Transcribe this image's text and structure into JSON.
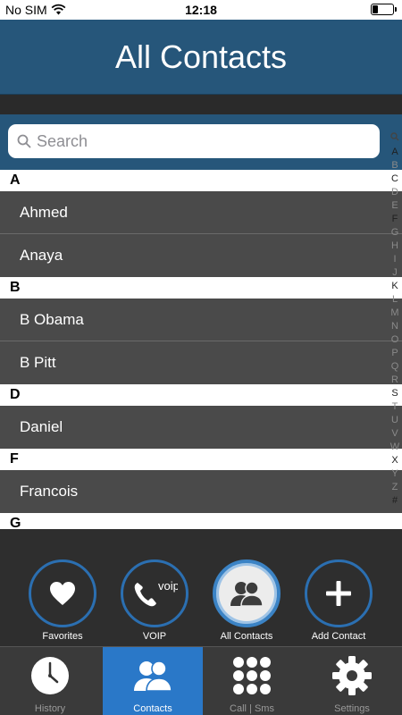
{
  "status_bar": {
    "carrier": "No SIM",
    "time": "12:18",
    "battery_level": 0.25
  },
  "header": {
    "title": "All Contacts"
  },
  "search": {
    "placeholder": "Search"
  },
  "sections": [
    {
      "letter": "A",
      "contacts": [
        "Ahmed",
        "Anaya"
      ]
    },
    {
      "letter": "B",
      "contacts": [
        "B Obama",
        "B Pitt"
      ]
    },
    {
      "letter": "D",
      "contacts": [
        "Daniel"
      ]
    },
    {
      "letter": "F",
      "contacts": [
        "Francois"
      ]
    },
    {
      "letter": "G",
      "contacts": []
    }
  ],
  "index_letters": [
    "A",
    "B",
    "C",
    "D",
    "E",
    "F",
    "G",
    "H",
    "I",
    "J",
    "K",
    "L",
    "M",
    "N",
    "O",
    "P",
    "Q",
    "R",
    "S",
    "T",
    "U",
    "V",
    "W",
    "X",
    "Y",
    "Z",
    "#"
  ],
  "action_buttons": [
    {
      "label": "Favorites",
      "icon": "heart-icon"
    },
    {
      "label": "VOIP",
      "icon": "voip-phone-icon",
      "icon_text": "voip"
    },
    {
      "label": "All Contacts",
      "icon": "contacts-icon",
      "active": true
    },
    {
      "label": "Add Contact",
      "icon": "plus-icon"
    }
  ],
  "tabs": [
    {
      "label": "History",
      "icon": "clock-icon"
    },
    {
      "label": "Contacts",
      "icon": "contacts-icon",
      "active": true
    },
    {
      "label": "Call | Sms",
      "icon": "keypad-icon"
    },
    {
      "label": "Settings",
      "icon": "gear-icon"
    }
  ],
  "colors": {
    "header_bg": "#26567a",
    "accent": "#2a78c8",
    "row_bg": "#4a4a4a",
    "ring": "#2b6fb1"
  }
}
